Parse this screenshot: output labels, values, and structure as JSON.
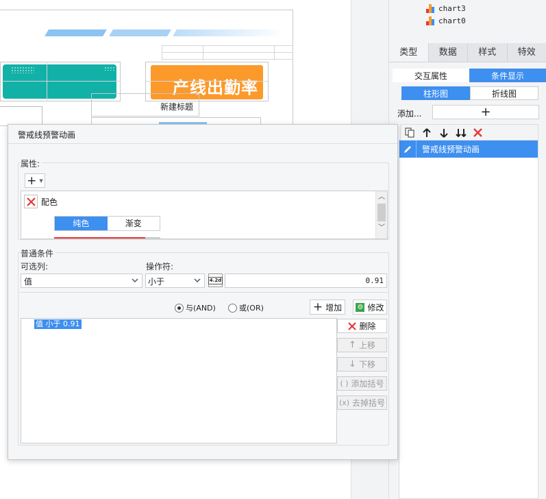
{
  "tree": {
    "items": [
      {
        "label": "chart3"
      },
      {
        "label": "chart0"
      }
    ]
  },
  "canvas": {
    "orange_title": "产线出勤率",
    "new_title": "新建标题"
  },
  "right_panel": {
    "tabs": [
      "类型",
      "数据",
      "样式",
      "特效"
    ],
    "active_tab": "类型",
    "sub_tabs": [
      "交互属性",
      "条件显示"
    ],
    "sub_tabs_active": "条件显示",
    "chart_tabs": [
      "柱形图",
      "折线图"
    ],
    "chart_tabs_active": "柱形图",
    "add_label": "添加...",
    "add_symbol": "+",
    "list_items": [
      {
        "label": "警戒线预警动画"
      }
    ]
  },
  "dialog": {
    "title": "警戒线预警动画",
    "properties": {
      "label": "属性:",
      "add_symbol": "+",
      "item_label": "配色",
      "color_tabs": [
        "纯色",
        "渐变"
      ],
      "color_tabs_active": "纯色"
    },
    "condition": {
      "group_label": "普通条件",
      "column_label": "可选列:",
      "operator_label": "操作符:",
      "column_value": "值",
      "operator_value": "小于",
      "type_badge": "4.2d",
      "compare_value": "0.91",
      "radio_and": "与(AND)",
      "radio_or": "或(OR)",
      "radio_selected": "and",
      "add_button": "增加",
      "modify_button": "修改",
      "condition_list": [
        "值 小于 0.91"
      ],
      "delete_button": "删除",
      "move_up_button": "上移",
      "move_down_button": "下移",
      "add_bracket_button": "添加括号",
      "remove_bracket_button": "去掉括号"
    }
  },
  "colors": {
    "accent": "#3d8ff0",
    "teal": "#12b1a8",
    "orange": "#fb9a2b",
    "delete_red": "#e53935",
    "stripe_blue": "#8cc3f2"
  }
}
